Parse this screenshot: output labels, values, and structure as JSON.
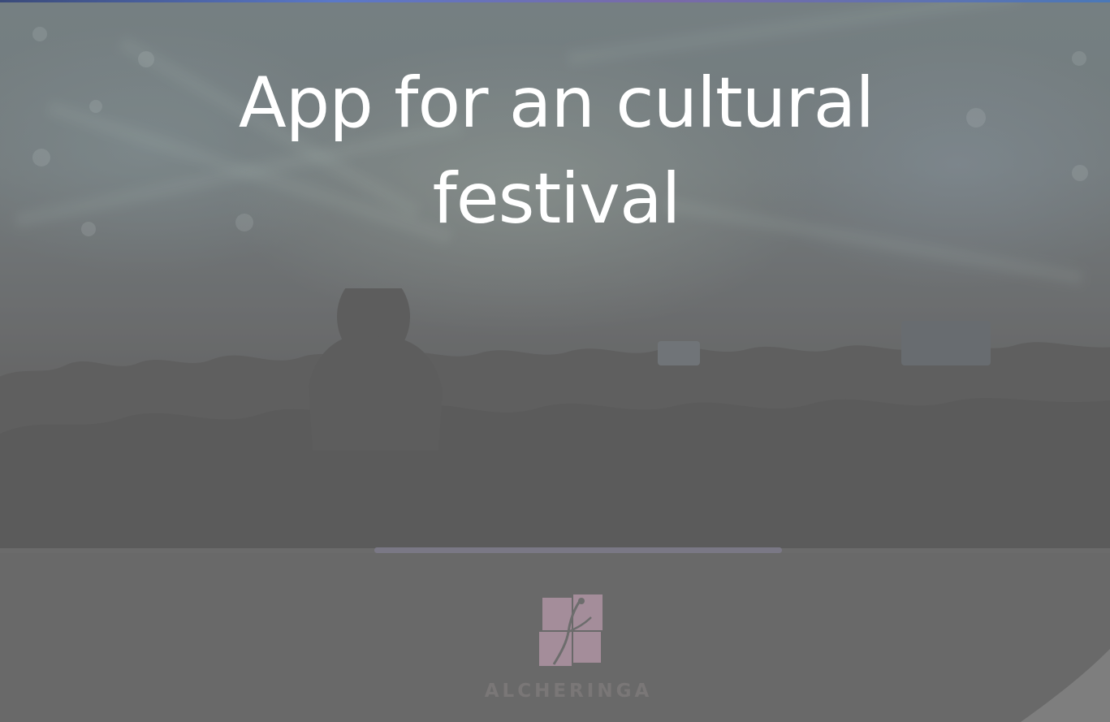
{
  "slide": {
    "headline_line1": "App for an cultural",
    "headline_line2": "festival"
  },
  "progress": {
    "value": 1.0
  },
  "logo": {
    "icon": "dancer-logo-icon",
    "wordmark": "ALCHERINGA"
  },
  "colors": {
    "accent_logo": "#b89aab",
    "headline_text": "#ffffff"
  }
}
